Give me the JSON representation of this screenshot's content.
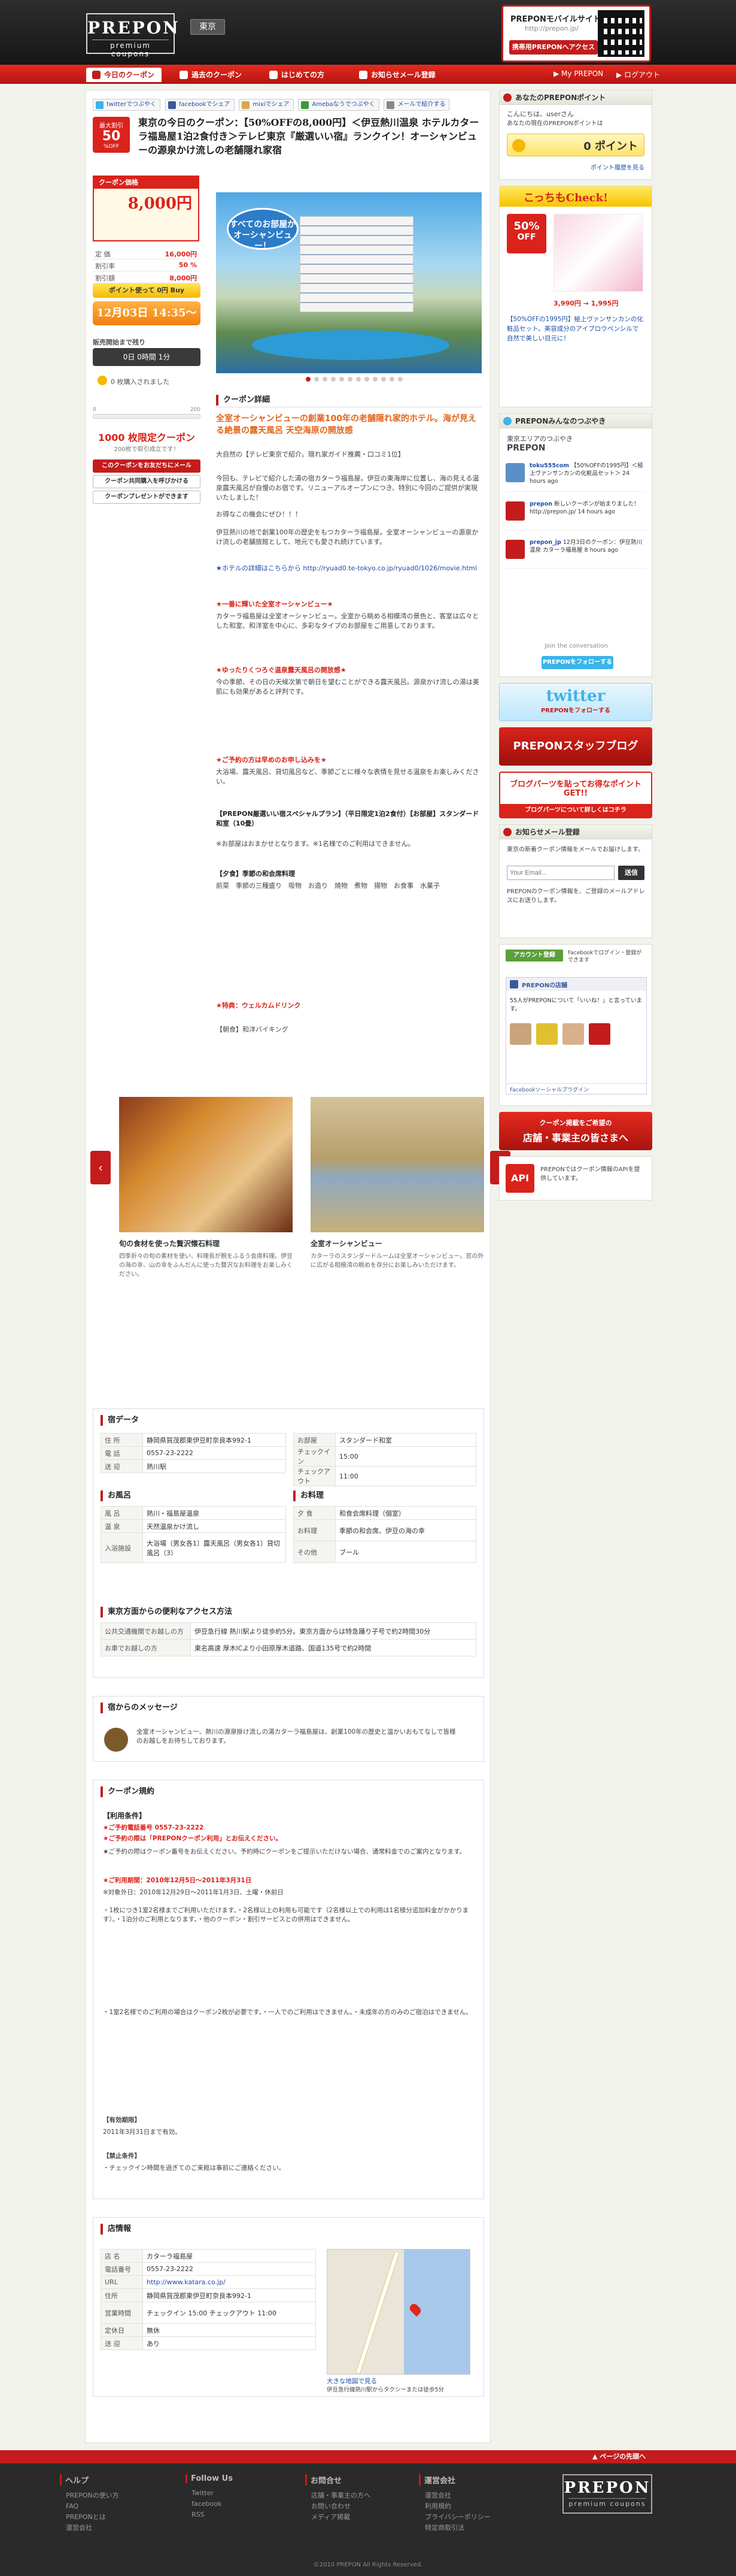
{
  "header": {
    "logo_main": "PREPON",
    "logo_sub": "premium coupons",
    "region": "東京",
    "mobile_title": "PREPONモバイルサイト",
    "mobile_url": "http://prepon.jp/",
    "mobile_button": "携帯用PREPONへアクセス"
  },
  "nav": {
    "tabs": [
      "今日のクーポン",
      "過去のクーポン",
      "はじめての方",
      "お知らせメール登録"
    ],
    "right": [
      "▶ My PREPON",
      "▶ ログアウト"
    ]
  },
  "share": [
    "twitterでつぶやく",
    "facebookでシェア",
    "mixiでシェア",
    "Amebaなうでつぶやく",
    "メールで紹介する"
  ],
  "deal": {
    "badge_top": "最大割引",
    "badge_pct": "50",
    "badge_off": "%OFF",
    "title": "東京の今日のクーポン：【50%OFFの8,000円】＜伊豆熱川温泉 ホテルカターラ福島屋1泊2食付き＞テレビ東京『厳選いい宿』ランクイン！オーシャンビューの源泉かけ流しの老舗隠れ家宿",
    "price_label": "クーポン価格",
    "price": "8,000円",
    "rows": [
      {
        "k": "定 価",
        "v": "16,000円"
      },
      {
        "k": "割引率",
        "v": "50 %"
      },
      {
        "k": "割引額",
        "v": "8,000円"
      }
    ],
    "points": "ポイント使って 0円 Buy",
    "buy_button": "12月03日 14:35～",
    "timer_label": "販売開始まで残り",
    "timer": "0日 0時間 1分",
    "bought": "0 枚購入されました",
    "progress_left": "0",
    "progress_right": "200",
    "progress_fraction": 0,
    "min_big": "1000 枚限定クーポン",
    "min_small": "200枚で取引成立です！",
    "btn_friend": "このクーポンをお友だちにメール",
    "btn_invite": "クーポン共同購入を呼びかける",
    "btn_gift": "クーポンプレゼントができます"
  },
  "hero": {
    "bubble": "すべてのお部屋が オーシャンビュー！"
  },
  "detail": {
    "heading": "クーポン詳細",
    "lead": "全室オーシャンビューの創業100年の老舗隠れ家的ホテル。海が見える絶景の露天風呂 天空海原の開放感",
    "p1": "大自然の【テレビ東京で紹介。隠れ家ガイド推薦・口コミ1位】",
    "p2": "今回も、テレビで紹介した湯の宿カターラ福島屋。伊豆の東海岸に位置し、海の見える温泉露天風呂が自慢のお宿です。リニューアルオープンにつき、特別に今回のご提供が実現いたしました！",
    "p3": "お得なこの機会にぜひ！！！",
    "p4": "伊豆熱川の地で創業100年の歴史をもつカターラ福島屋。全室オーシャンビューの源泉かけ流しの老舗旅館として、地元でも愛され続けています。",
    "p5": "★ホテルの詳細はこちらから http://ryuad0.te-tokyo.co.jp/ryuad0/1026/movie.html",
    "red1": "★一番に輝いた全室オーシャンビュー★",
    "p6": "カターラ福島屋は全室オーシャンビュー。全室から眺める相模湾の景色と、客室は広々とした和室、和洋室を中心に、多彩なタイプのお部屋をご用意しております。",
    "red2": "★ゆったりくつろぐ温泉露天風呂の開放感★",
    "p7": "今の季節、その日の天候次第で朝日を望むことができる露天風呂。源泉かけ流しの湯は美肌にも効果があると評判です。",
    "red3": "★ご予約の方は早めのお申し込みを★",
    "p8": "大浴場、露天風呂、貸切風呂など、季節ごとに様々な表情を見せる温泉をお楽しみください。",
    "bold1": "【PREPON厳選いい宿スペシャルプラン】（平日限定1泊2食付）【お部屋】スタンダード和室（10畳）",
    "p9": "※お部屋はおまかせとなります。※1名様でのご利用はできません。",
    "bold2": "【夕食】季節の和会席料理",
    "p10": "前菜　季節の三種盛り　吸物　お造り　焼物　煮物　揚物　お食事　水菓子",
    "red4": "★特典：ウェルカムドリンク",
    "p11": "【朝食】和洋バイキング",
    "thumb_count": 12
  },
  "slider": {
    "left": "‹",
    "right": "›",
    "cards": [
      {
        "cap": "旬の食材を使った贅沢懐石料理",
        "desc": "四季折々の旬の素材を使い、料理長が腕をふるう会席料理。伊豆の海の幸、山の幸をふんだんに使った贅沢なお料理をお楽しみください。"
      },
      {
        "cap": "全室オーシャンビュー",
        "desc": "カターラのスタンダードルームは全室オーシャンビュー。窓の外に広がる相模湾の眺めを存分にお楽しみいただけます。"
      }
    ]
  },
  "hotel_data": {
    "heading": "宿データ",
    "left": [
      {
        "k": "住 所",
        "v": "静岡県賀茂郡東伊豆町奈良本992-1"
      },
      {
        "k": "電 話",
        "v": "0557-23-2222"
      },
      {
        "k": "送 迎",
        "v": "熱川駅"
      }
    ],
    "right": [
      {
        "k": "お部屋",
        "v": "スタンダード和室"
      },
      {
        "k": "チェックイン",
        "v": "15:00"
      },
      {
        "k": "チェックアウト",
        "v": "11:00"
      }
    ]
  },
  "bath": {
    "heading": "お風呂",
    "rows": [
      {
        "k": "風 呂",
        "v": "熱川・福島屋温泉"
      },
      {
        "k": "温 泉",
        "v": "天然温泉かけ流し"
      },
      {
        "k": "入浴施設",
        "v": "大浴場（男女各1）露天風呂（男女各1）貸切風呂（3）"
      }
    ]
  },
  "food": {
    "heading": "お料理",
    "rows": [
      {
        "k": "夕 食",
        "v": "和食会席料理（個室）"
      },
      {
        "k": "お料理",
        "v": "季節の和会席、伊豆の海の幸"
      },
      {
        "k": "その他",
        "v": "ブール"
      }
    ]
  },
  "access": {
    "heading": "東京方面からの便利なアクセス方法",
    "rows": [
      {
        "k": "公共交通機関でお越しの方",
        "v": "伊豆急行線 熱川駅より徒歩約5分。東京方面からは特急踊り子号で約2時間30分"
      },
      {
        "k": "お車でお越しの方",
        "v": "東名高速 厚木ICより小田原厚木道路、国道135号で約2時間"
      }
    ]
  },
  "message": {
    "heading": "宿からのメッセージ",
    "text": "全室オーシャンビュー、熱川の源泉掛け流しの湯カターラ福島屋は、創業100年の歴史と温かいおもてなしで皆様のお越しをお待ちしております。"
  },
  "terms": {
    "heading": "クーポン規約",
    "h1": "【利用条件】",
    "r1": "★ご予約電話番号 0557-23-2222",
    "r2": "★ご予約の際は「PREPONクーポン利用」とお伝えください。",
    "p1": "★ご予約の際はクーポン番号をお伝えください。予約時にクーポンをご提示いただけない場合、通常料金でのご案内となります。",
    "r3": "★ご利用期間：2010年12月5日～2011年3月31日",
    "p2": "※対象外日：2010年12月29日～2011年1月3日、土曜・休前日",
    "p3": "・1枚につき1室2名様までご利用いただけます。・2名様以上の利用も可能です（2名様以上での利用は1名様分追加料金がかかります）。・1泊分のご利用となります。・他のクーポン・割引サービスとの併用はできません。",
    "p4": "・1室2名様でのご利用の場合はクーポン2枚が必要です。・一人でのご利用はできません。・未成年の方のみのご宿泊はできません。",
    "h2": "【有効期限】",
    "p5": "2011年3月31日まで有効。",
    "h3": "【禁止条件】",
    "p6": "・チェックイン時間を過ぎてのご来館は事前にご連絡ください。"
  },
  "store": {
    "heading": "店情報",
    "rows": [
      {
        "k": "店 名",
        "v": "カターラ福島屋"
      },
      {
        "k": "電話番号",
        "v": "0557-23-2222"
      },
      {
        "k": "URL",
        "v": "http://www.katara.co.jp/"
      },
      {
        "k": "住所",
        "v": "静岡県賀茂郡東伊豆町奈良本992-1"
      },
      {
        "k": "営業時間",
        "v": "チェックイン 15:00 チェックアウト 11:00"
      },
      {
        "k": "定休日",
        "v": "無休"
      },
      {
        "k": "送 迎",
        "v": "あり"
      }
    ],
    "map_caption": "大きな地図で見る",
    "map_note": "伊豆急行線熱川駅からタクシーまたは徒歩5分"
  },
  "sidebar": {
    "point_h": "あなたのPREPONポイント",
    "point_user": "こんにちは、userさん",
    "point_note": "あなたの現在のPREPONポイントは",
    "point_value": "0 ポイント",
    "point_link": "ポイント履歴を見る",
    "check_h": "こっちもCheck!",
    "check_pct": "50%",
    "check_off": "OFF",
    "check_price": "3,990円 → 1,995円",
    "check_text": "【50%OFFの1995円】極上ヴァンサンカンの化粧品セット。美容成分のアイブロウペンシルで自然で美しい目元に！",
    "tw_h": "PREPONみんなのつぶやき",
    "tw_sub": "東京エリアのつぶやき",
    "tw_brand": "PREPON",
    "tweets": [
      {
        "u": "toku555com",
        "t": "【50%OFFの1995円】＜極上ヴァンサンカンの化粧品セット＞ 24 hours ago"
      },
      {
        "u": "prepon",
        "t": "新しいクーポンが始まりました！ http://prepon.jp/ 14 hours ago"
      },
      {
        "u": "prepon_jp",
        "t": "12月3日のクーポン：伊豆熱川温泉 カターラ福島屋 8 hours ago"
      }
    ],
    "tw_join": "Join the conversation",
    "tw_follow": "PREPONをフォローする",
    "twitter_logo": "twitter",
    "twitter_sub": "PREPONをフォローする",
    "staff_banner": "PREPONスタッフブログ",
    "blog_banner1": "ブログパーツを貼ってお得なポイントGET!!",
    "blog_banner2": "ブログパーツについて詳しくはコチラ",
    "mail_h": "お知らせメール登録",
    "mail_text": "東京の新着クーポン情報をメールでお届けします。",
    "mail_placeholder": "Your Email...",
    "mail_btn": "送信",
    "mail_note": "PREPONのクーポン情報を、ご登録のメールアドレスにお送りします。",
    "fb_h": "アカウント登録",
    "fb_text": "Facebookでログイン・登録ができます",
    "fb_like": "PREPONの店舗",
    "fb_count": "55人がPREPONについて「いいね！」と言っています。",
    "fb_plugin": "Facebookソーシャルプラグイン",
    "store_banner1": "クーポン掲載をご希望の",
    "store_banner2": "店舗・事業主の皆さまへ",
    "api_label": "API",
    "api_text": "PREPONではクーポン情報のAPIを提供しています。"
  },
  "footer": {
    "pagetop": "▲ ページの先頭へ",
    "cols": [
      {
        "h": "ヘルプ",
        "items": [
          "PREPONの使い方",
          "FAQ",
          "PREPONとは",
          "運営会社"
        ]
      },
      {
        "h": "Follow Us",
        "items": [
          "Twitter",
          "facebook",
          "RSS"
        ]
      },
      {
        "h": "お問合せ",
        "items": [
          "店舗・事業主の方へ",
          "お問い合わせ",
          "メディア掲載"
        ]
      },
      {
        "h": "運営会社",
        "items": [
          "運営会社",
          "利用規約",
          "プライバシーポリシー",
          "特定商取引法"
        ]
      }
    ],
    "logo_main": "PREPON",
    "logo_sub": "premium coupons",
    "copyright": "©2010 PREPON All Rights Reserved."
  }
}
